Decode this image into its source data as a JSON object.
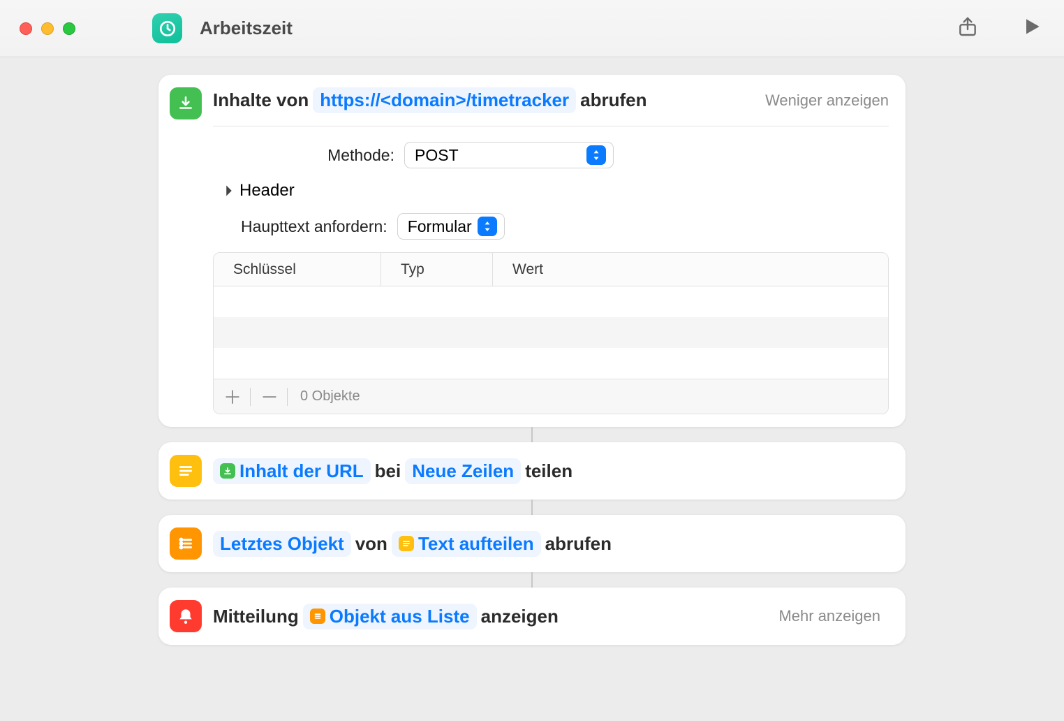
{
  "window": {
    "title": "Arbeitszeit"
  },
  "action1": {
    "prefix": "Inhalte von",
    "url": "https://<domain>/timetracker",
    "suffix": "abrufen",
    "toggle": "Weniger anzeigen",
    "method_label": "Methode:",
    "method_value": "POST",
    "header_label": "Header",
    "body_label": "Haupttext anfordern:",
    "body_value": "Formular",
    "table": {
      "col_key": "Schlüssel",
      "col_type": "Typ",
      "col_value": "Wert",
      "count": "0 Objekte"
    }
  },
  "action2": {
    "token1": "Inhalt der URL",
    "mid": "bei",
    "token2": "Neue Zeilen",
    "suffix": "teilen"
  },
  "action3": {
    "token1": "Letztes Objekt",
    "mid": "von",
    "token2": "Text aufteilen",
    "suffix": "abrufen"
  },
  "action4": {
    "prefix": "Mitteilung",
    "token": "Objekt aus Liste",
    "suffix": "anzeigen",
    "toggle": "Mehr anzeigen"
  }
}
